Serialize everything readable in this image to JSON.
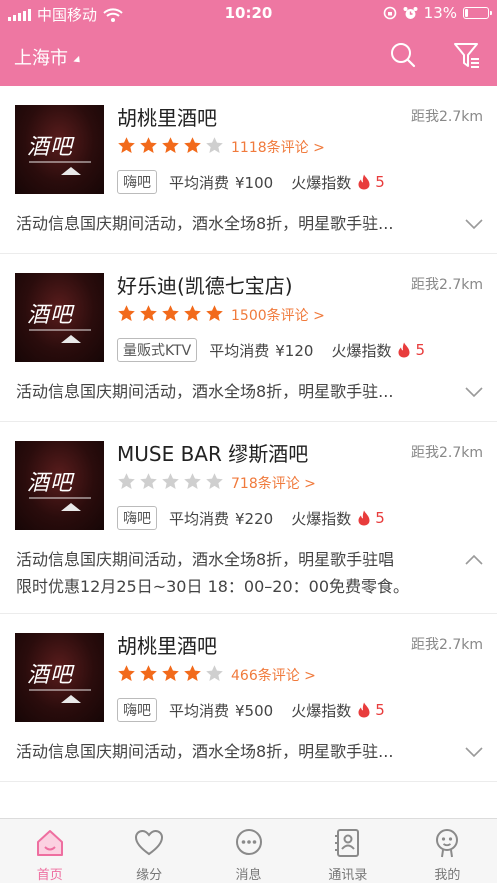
{
  "status_bar": {
    "carrier": "中国移动",
    "time": "10:20",
    "battery": "13%"
  },
  "header": {
    "city": "上海市"
  },
  "icons": {
    "search": "search-icon",
    "filter": "filter-icon",
    "dropdown": "caret-down-icon"
  },
  "colors": {
    "brand": "#ee77a2",
    "star_on": "#f26a1b",
    "star_off": "#cfcfcf",
    "review": "#f07a3c",
    "hot": "#e83c3c"
  },
  "venues": [
    {
      "name": "胡桃里酒吧",
      "distance": "距我2.7km",
      "rating": 4,
      "reviews": "1118条评论 >",
      "tag": "嗨吧",
      "avg_label": "平均消费",
      "avg_price": "¥100",
      "hot_label": "火爆指数",
      "hot_value": "5",
      "activity": "活动信息国庆期间活动，酒水全场8折，明星歌手驻...",
      "activity_line2": "",
      "expanded": false,
      "image_caption": "酒吧"
    },
    {
      "name": "好乐迪(凯德七宝店)",
      "distance": "距我2.7km",
      "rating": 5,
      "reviews": "1500条评论 >",
      "tag": "量贩式KTV",
      "avg_label": "平均消费",
      "avg_price": "¥120",
      "hot_label": "火爆指数",
      "hot_value": "5",
      "activity": "活动信息国庆期间活动，酒水全场8折，明星歌手驻...",
      "activity_line2": "",
      "expanded": false,
      "image_caption": "酒吧"
    },
    {
      "name": "MUSE BAR 缪斯酒吧",
      "distance": "距我2.7km",
      "rating": 0,
      "reviews": "718条评论 >",
      "tag": "嗨吧",
      "avg_label": "平均消费",
      "avg_price": "¥220",
      "hot_label": "火爆指数",
      "hot_value": "5",
      "activity": "活动信息国庆期间活动，酒水全场8折，明星歌手驻唱",
      "activity_line2": "限时优惠12月25日~30日 18：00–20：00免费零食。",
      "expanded": true,
      "image_caption": "酒吧"
    },
    {
      "name": "胡桃里酒吧",
      "distance": "距我2.7km",
      "rating": 4,
      "reviews": "466条评论 >",
      "tag": "嗨吧",
      "avg_label": "平均消费",
      "avg_price": "¥500",
      "hot_label": "火爆指数",
      "hot_value": "5",
      "activity": "活动信息国庆期间活动，酒水全场8折，明星歌手驻...",
      "activity_line2": "",
      "expanded": false,
      "image_caption": "酒吧"
    }
  ],
  "tabbar": [
    {
      "label": "首页",
      "icon": "home-icon",
      "active": true
    },
    {
      "label": "缘分",
      "icon": "heart-icon",
      "active": false
    },
    {
      "label": "消息",
      "icon": "chat-bubble-icon",
      "active": false
    },
    {
      "label": "通讯录",
      "icon": "contacts-book-icon",
      "active": false
    },
    {
      "label": "我的",
      "icon": "profile-face-icon",
      "active": false
    }
  ]
}
